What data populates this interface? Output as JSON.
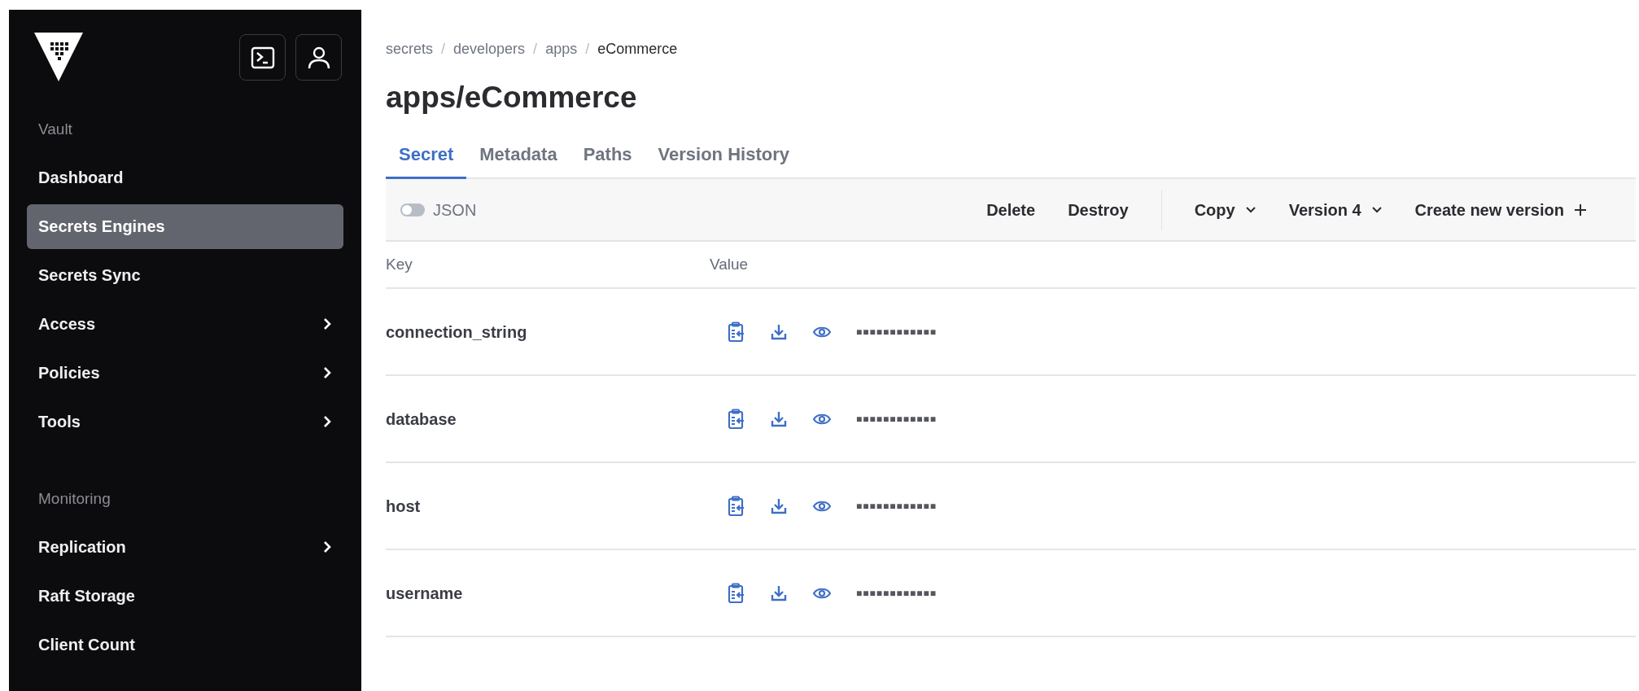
{
  "sidebar": {
    "sections": [
      {
        "heading": "Vault",
        "items": [
          {
            "label": "Dashboard",
            "selected": false,
            "submenu": false
          },
          {
            "label": "Secrets Engines",
            "selected": true,
            "submenu": false
          },
          {
            "label": "Secrets Sync",
            "selected": false,
            "submenu": false
          },
          {
            "label": "Access",
            "selected": false,
            "submenu": true
          },
          {
            "label": "Policies",
            "selected": false,
            "submenu": true
          },
          {
            "label": "Tools",
            "selected": false,
            "submenu": true
          }
        ]
      },
      {
        "heading": "Monitoring",
        "items": [
          {
            "label": "Replication",
            "selected": false,
            "submenu": true
          },
          {
            "label": "Raft Storage",
            "selected": false,
            "submenu": false
          },
          {
            "label": "Client Count",
            "selected": false,
            "submenu": false
          }
        ]
      }
    ]
  },
  "breadcrumbs": [
    {
      "label": "secrets",
      "current": false
    },
    {
      "label": "developers",
      "current": false
    },
    {
      "label": "apps",
      "current": false
    },
    {
      "label": "eCommerce",
      "current": true
    }
  ],
  "breadcrumb_separator": "/",
  "title": "apps/eCommerce",
  "tabs": [
    {
      "label": "Secret",
      "selected": true
    },
    {
      "label": "Metadata",
      "selected": false
    },
    {
      "label": "Paths",
      "selected": false
    },
    {
      "label": "Version History",
      "selected": false
    }
  ],
  "toolbar": {
    "json_toggle": {
      "label": "JSON",
      "on": false
    },
    "actions": [
      {
        "label": "Delete",
        "kind": "plain"
      },
      {
        "label": "Destroy",
        "kind": "plain"
      },
      {
        "label": "Copy",
        "kind": "dropdown"
      },
      {
        "label": "Version 4",
        "kind": "dropdown"
      },
      {
        "label": "Create new version",
        "kind": "add"
      }
    ]
  },
  "table": {
    "columns": [
      "Key",
      "Value"
    ],
    "rows": [
      {
        "key": "connection_string",
        "value": "■■■■■■■■■■■■"
      },
      {
        "key": "database",
        "value": "■■■■■■■■■■■■"
      },
      {
        "key": "host",
        "value": "■■■■■■■■■■■■"
      },
      {
        "key": "username",
        "value": "■■■■■■■■■■■■"
      }
    ]
  }
}
